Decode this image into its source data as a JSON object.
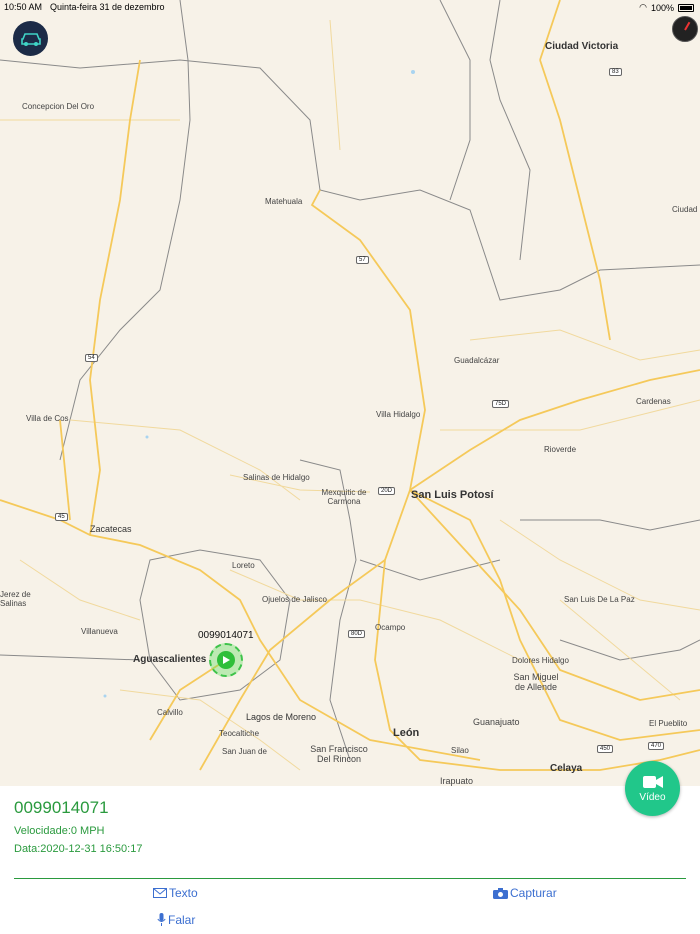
{
  "status": {
    "time": "10:50 AM",
    "date": "Quinta-feira 31 de dezembro",
    "battery": "100%"
  },
  "map": {
    "cities": [
      {
        "key": "ciudad_victoria",
        "text": "Ciudad Victoria"
      },
      {
        "key": "concepcion",
        "text": "Concepcion Del Oro"
      },
      {
        "key": "matehuala",
        "text": "Matehuala"
      },
      {
        "key": "ciudad_edge",
        "text": "Ciudad"
      },
      {
        "key": "guadalcazar",
        "text": "Guadalcázar"
      },
      {
        "key": "villa_cos",
        "text": "Villa de Cos"
      },
      {
        "key": "villa_hidalgo",
        "text": "Villa Hidalgo"
      },
      {
        "key": "cardenas",
        "text": "Cardenas"
      },
      {
        "key": "rioverde",
        "text": "Rioverde"
      },
      {
        "key": "salinas",
        "text": "Salinas de Hidalgo"
      },
      {
        "key": "mexquitic",
        "text": "Mexquitic de Carmona"
      },
      {
        "key": "slp",
        "text": "San Luis Potosí"
      },
      {
        "key": "zacatecas",
        "text": "Zacatecas"
      },
      {
        "key": "loreto",
        "text": "Loreto"
      },
      {
        "key": "jerez",
        "text": "Jerez de Salinas"
      },
      {
        "key": "ojuelos",
        "text": "Ojuelos de Jalisco"
      },
      {
        "key": "sl_paz",
        "text": "San Luis De La Paz"
      },
      {
        "key": "villanueva",
        "text": "Villanueva"
      },
      {
        "key": "ocampo",
        "text": "Ocampo"
      },
      {
        "key": "aguascalientes",
        "text": "Aguascalientes"
      },
      {
        "key": "dolores",
        "text": "Dolores Hidalgo"
      },
      {
        "key": "sma",
        "text": "San Miguel de Allende"
      },
      {
        "key": "calvillo",
        "text": "Calvillo"
      },
      {
        "key": "lagos",
        "text": "Lagos de Moreno"
      },
      {
        "key": "guanajuato",
        "text": "Guanajuato"
      },
      {
        "key": "el_pueblito",
        "text": "El Pueblito"
      },
      {
        "key": "teocaltiche",
        "text": "Teocaltiche"
      },
      {
        "key": "leon",
        "text": "León"
      },
      {
        "key": "silao",
        "text": "Silao"
      },
      {
        "key": "san_juan",
        "text": "San Juan de"
      },
      {
        "key": "sf_rincon",
        "text": "San Francisco Del Rincon"
      },
      {
        "key": "irapuato",
        "text": "Irapuato"
      },
      {
        "key": "celaya",
        "text": "Celaya"
      }
    ],
    "shields": [
      "83",
      "57",
      "54",
      "75D",
      "20D",
      "45",
      "80D",
      "450",
      "470"
    ],
    "device_label": "0099014071"
  },
  "video_button": {
    "label": "Vídeo",
    "icon": "video-camera-icon"
  },
  "panel": {
    "title": "0099014071",
    "speed": "Velocidade:0 MPH",
    "date": "Data:2020-12-31 16:50:17"
  },
  "actions": {
    "texto": "Texto",
    "capturar": "Capturar",
    "falar": "Falar"
  },
  "colors": {
    "accent_green": "#2a9a3e",
    "action_blue": "#3c6fd0",
    "video_teal": "#21c78a"
  }
}
